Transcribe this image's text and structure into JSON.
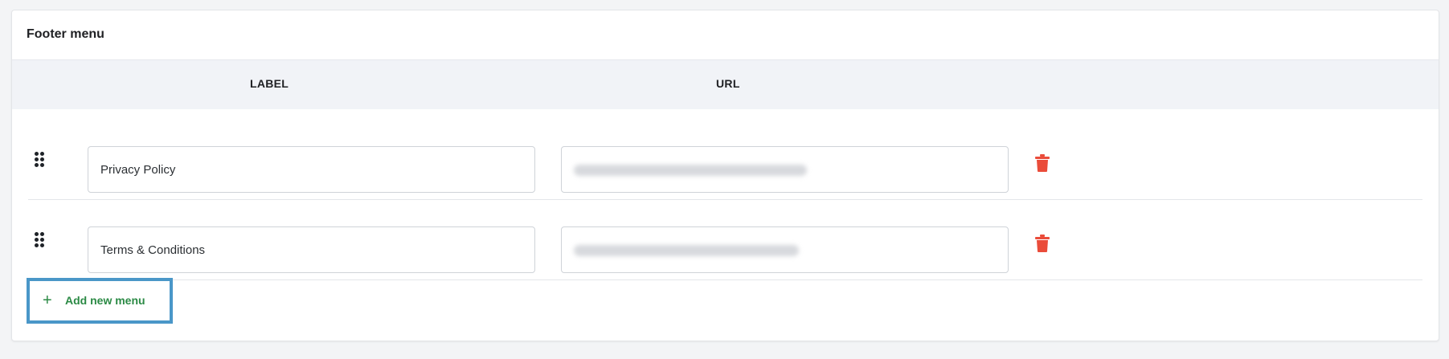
{
  "section": {
    "title": "Footer menu"
  },
  "columns": {
    "label": "LABEL",
    "url": "URL"
  },
  "rows": [
    {
      "label": "Privacy Policy",
      "url": ""
    },
    {
      "label": "Terms & Conditions",
      "url": ""
    }
  ],
  "actions": {
    "add_label": "Add new menu",
    "add_icon": "+"
  },
  "icons": {
    "drag": "drag-handle-icon",
    "delete": "trash-icon"
  },
  "colors": {
    "accent": "#2b8a45",
    "danger": "#ea4c3a",
    "highlight": "#4a97c8"
  }
}
